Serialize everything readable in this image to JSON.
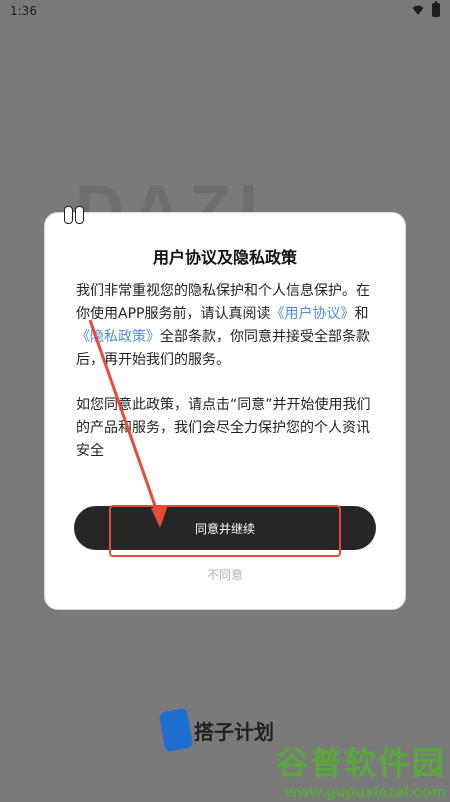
{
  "status_bar": {
    "time": "1:36"
  },
  "background": {
    "logo_text": "DAZI"
  },
  "dialog": {
    "title": "用户协议及隐私政策",
    "para1_a": "我们非常重视您的隐私保护和个人信息保护。在你使用APP服务前，请认真阅读",
    "user_agreement_link": "《用户协议》",
    "para1_b": "和",
    "privacy_policy_link": "《隐私政策》",
    "para1_c": "全部条款，你同意并接受全部条款后，再开始我们的服务。",
    "para2": "如您同意此政策，请点击“同意”并开始使用我们的产品和服务，我们会尽全力保护您的个人资讯安全",
    "agree_label": "同意并继续",
    "disagree_label": "不同意"
  },
  "brand": {
    "name": "搭子计划"
  },
  "watermark": {
    "title": "谷普软件园",
    "url": "www.gupuxlazal.com"
  },
  "colors": {
    "link": "#4a8fd8",
    "annotation": "#e84a3a",
    "button": "#262626"
  }
}
